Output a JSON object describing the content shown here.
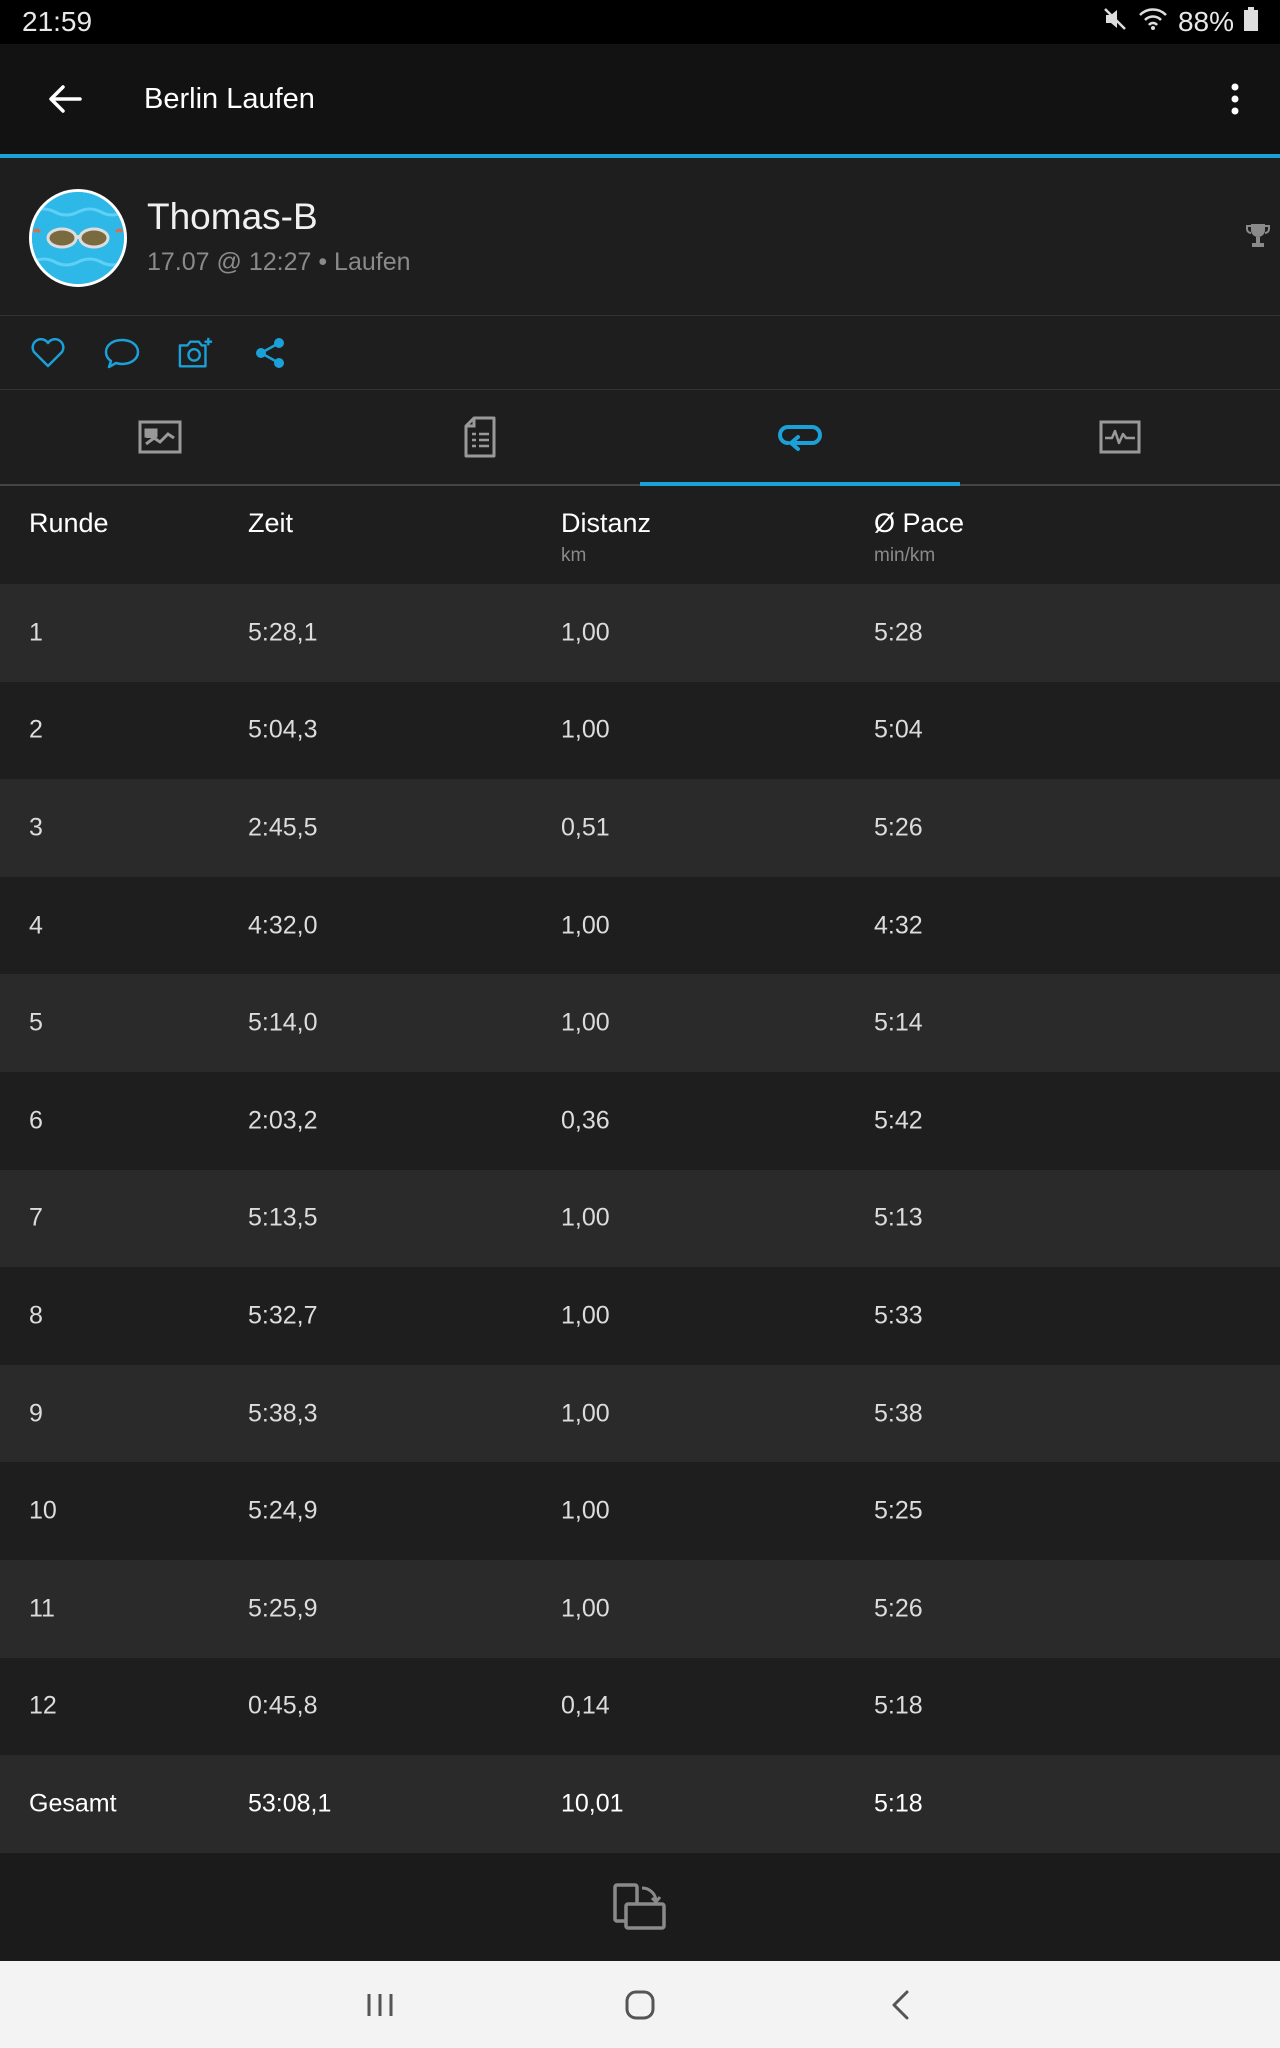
{
  "status": {
    "time": "21:59",
    "battery": "88%"
  },
  "appbar": {
    "title": "Berlin Laufen"
  },
  "profile": {
    "name": "Thomas-B",
    "subtitle": "17.07 @ 12:27 • Laufen"
  },
  "colors": {
    "accent": "#1ba0d8",
    "background": "#1e1e1e",
    "row_alt": "#2a2a2a"
  },
  "icons": [
    "back-arrow-icon",
    "more-vert-icon",
    "trophy-icon",
    "heart-icon",
    "comment-icon",
    "add-photo-icon",
    "share-icon",
    "map-tab-icon",
    "details-tab-icon",
    "laps-tab-icon",
    "charts-tab-icon",
    "export-icon"
  ],
  "table": {
    "headers": [
      {
        "label": "Runde",
        "unit": ""
      },
      {
        "label": "Zeit",
        "unit": ""
      },
      {
        "label": "Distanz",
        "unit": "km"
      },
      {
        "label": "Ø Pace",
        "unit": "min/km"
      }
    ],
    "rows": [
      [
        "1",
        "5:28,1",
        "1,00",
        "5:28"
      ],
      [
        "2",
        "5:04,3",
        "1,00",
        "5:04"
      ],
      [
        "3",
        "2:45,5",
        "0,51",
        "5:26"
      ],
      [
        "4",
        "4:32,0",
        "1,00",
        "4:32"
      ],
      [
        "5",
        "5:14,0",
        "1,00",
        "5:14"
      ],
      [
        "6",
        "2:03,2",
        "0,36",
        "5:42"
      ],
      [
        "7",
        "5:13,5",
        "1,00",
        "5:13"
      ],
      [
        "8",
        "5:32,7",
        "1,00",
        "5:33"
      ],
      [
        "9",
        "5:38,3",
        "1,00",
        "5:38"
      ],
      [
        "10",
        "5:24,9",
        "1,00",
        "5:25"
      ],
      [
        "11",
        "5:25,9",
        "1,00",
        "5:26"
      ],
      [
        "12",
        "0:45,8",
        "0,14",
        "5:18"
      ]
    ],
    "total": [
      "Gesamt",
      "53:08,1",
      "10,01",
      "5:18"
    ]
  }
}
